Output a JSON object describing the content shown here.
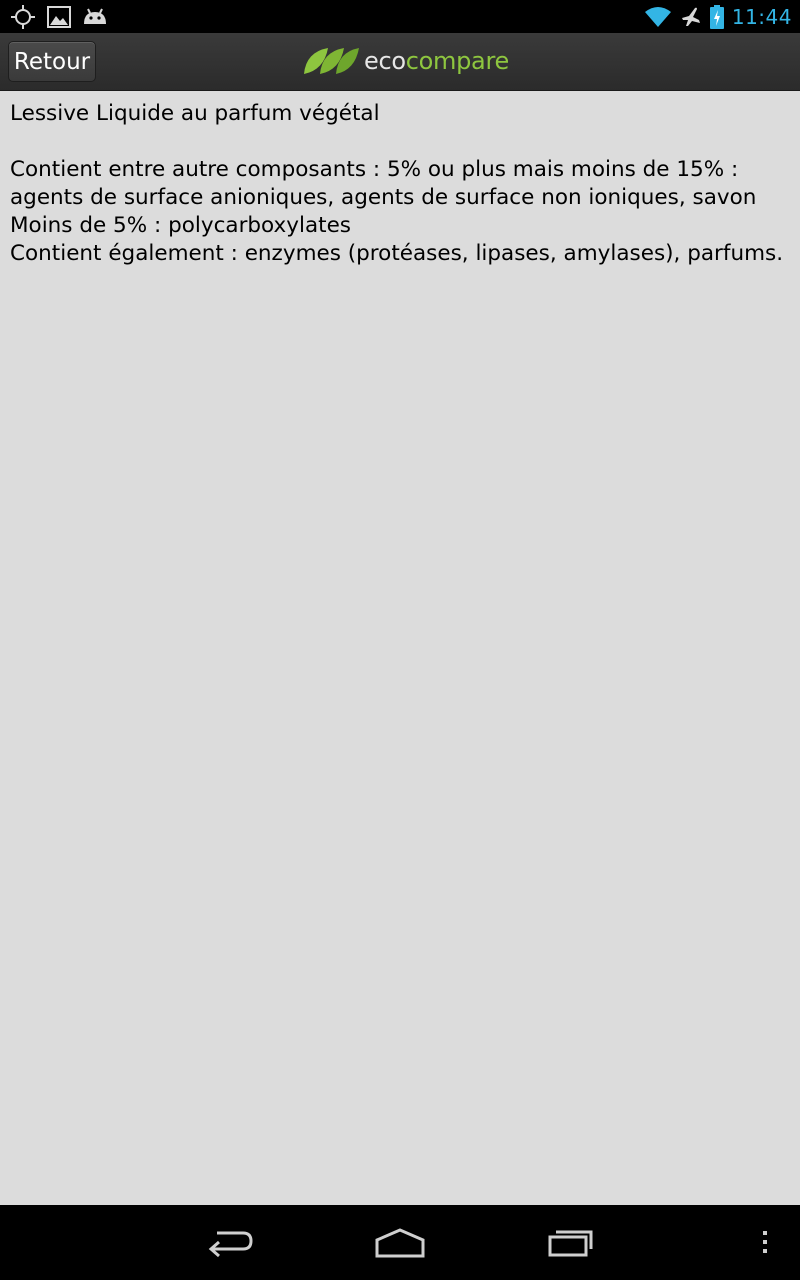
{
  "status_bar": {
    "left_icons": [
      "gps-icon",
      "image-icon",
      "android-icon"
    ],
    "right_icons": [
      "wifi-icon",
      "airplane-icon",
      "battery-charging-icon"
    ],
    "time": "11:44",
    "accent_color": "#33b5e5"
  },
  "action_bar": {
    "back_label": "Retour",
    "logo": {
      "part1": "eco",
      "part2": "compare",
      "brand_color": "#8ec63f"
    }
  },
  "content": {
    "title": "Lessive Liquide au parfum végétal",
    "lines": [
      "Contient entre autre composants : 5% ou plus mais moins de 15% :",
      "agents de surface anioniques, agents de surface non ioniques, savon",
      "Moins de 5% : polycarboxylates",
      "Contient également : enzymes (protéases, lipases, amylases), parfums."
    ]
  },
  "nav_bar": {
    "buttons": [
      "back-icon",
      "home-icon",
      "recent-apps-icon",
      "menu-icon"
    ]
  }
}
